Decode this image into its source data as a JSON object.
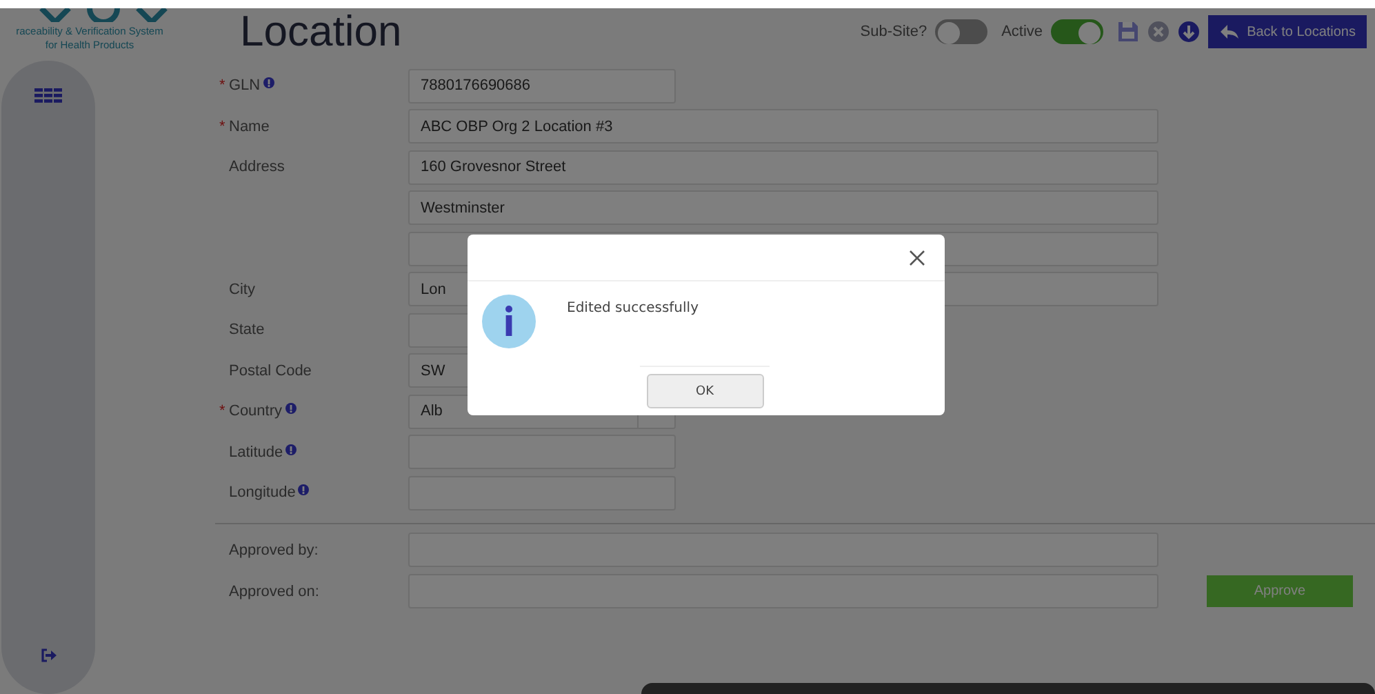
{
  "logo": {
    "tagline": [
      "raceability & Verification System",
      "for Health Products"
    ]
  },
  "page_title": "Location",
  "header": {
    "sub_site": {
      "label": "Sub-Site?",
      "on": false
    },
    "active": {
      "label": "Active",
      "on": true
    },
    "back_button": "Back to Locations"
  },
  "fields": [
    {
      "label": "GLN",
      "marker": "*",
      "info": true,
      "value": "7880176690686",
      "kind": "short"
    },
    {
      "label": "Name",
      "marker": "*",
      "info": false,
      "value": "ABC OBP Org 2 Location #3",
      "kind": "long"
    },
    {
      "label": "Address",
      "info": false,
      "value": "160 Grovesnor Street",
      "kind": "long"
    },
    {
      "info": false,
      "value": "Westminster",
      "kind": "long"
    },
    {
      "info": false,
      "kind": "long"
    },
    {
      "label": "City",
      "info": false,
      "value": "Lon",
      "kind": "long"
    },
    {
      "label": "State",
      "info": false,
      "kind": "short"
    },
    {
      "label": "Postal Code",
      "info": false,
      "value": "SW",
      "kind": "short"
    },
    {
      "label": "Country",
      "marker": "*",
      "info": true,
      "value": "Alb",
      "kind": "select"
    },
    {
      "label": "Latitude",
      "info": true,
      "kind": "short"
    },
    {
      "label": "Longitude",
      "info": true,
      "kind": "short"
    }
  ],
  "approval": [
    {
      "label": "Approved by:"
    },
    {
      "label": "Approved on:"
    }
  ],
  "approve_button": "Approve",
  "dialog": {
    "message": "Edited successfully",
    "ok_button": "OK"
  }
}
